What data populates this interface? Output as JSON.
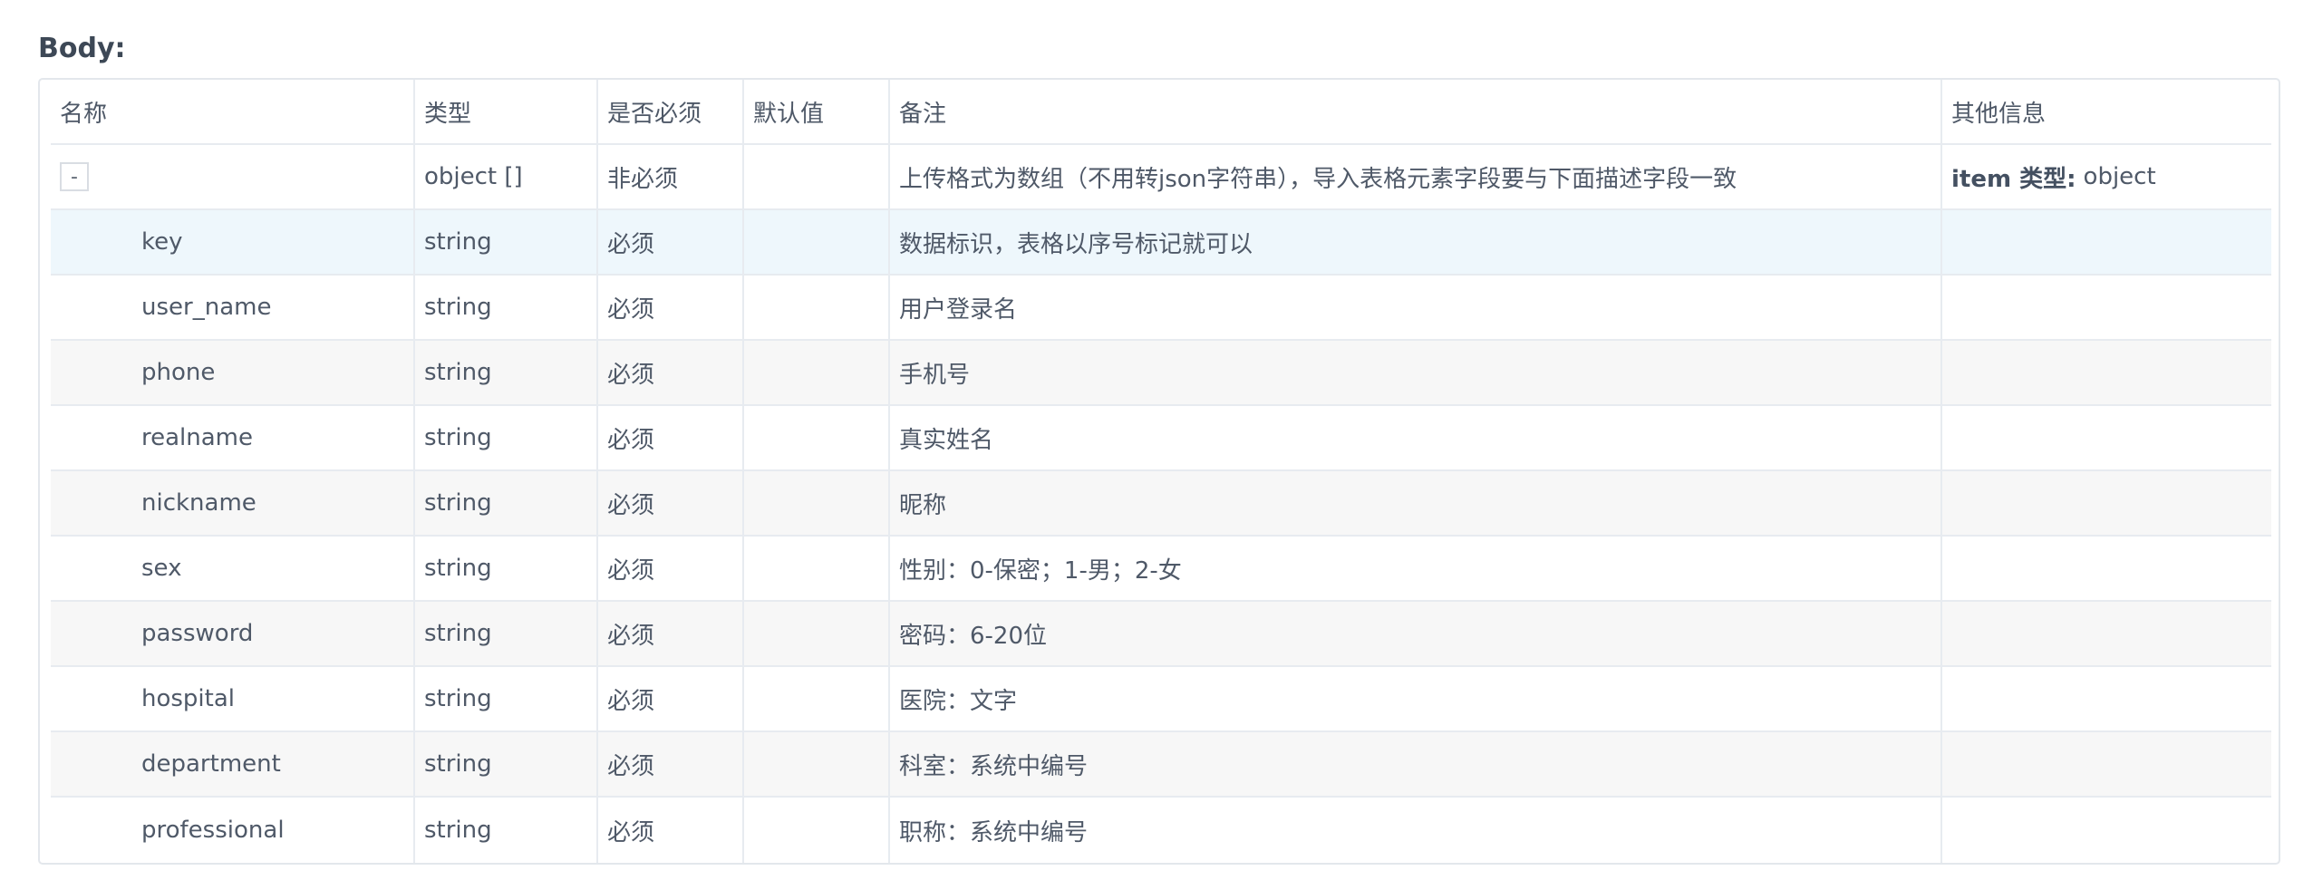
{
  "section_title": "Body:",
  "columns": [
    "名称",
    "类型",
    "是否必须",
    "默认值",
    "备注",
    "其他信息"
  ],
  "root_row": {
    "toggle_label": "-",
    "type": "object []",
    "required": "非必须",
    "default": "",
    "remark": "上传格式为数组（不用转json字符串），导入表格元素字段要与下面描述字段一致",
    "other_label": "item 类型:",
    "other_value": "object"
  },
  "rows": [
    {
      "name": "key",
      "type": "string",
      "required": "必须",
      "default": "",
      "remark": "数据标识，表格以序号标记就可以",
      "other": ""
    },
    {
      "name": "user_name",
      "type": "string",
      "required": "必须",
      "default": "",
      "remark": "用户登录名",
      "other": ""
    },
    {
      "name": "phone",
      "type": "string",
      "required": "必须",
      "default": "",
      "remark": "手机号",
      "other": ""
    },
    {
      "name": "realname",
      "type": "string",
      "required": "必须",
      "default": "",
      "remark": "真实姓名",
      "other": ""
    },
    {
      "name": "nickname",
      "type": "string",
      "required": "必须",
      "default": "",
      "remark": "昵称",
      "other": ""
    },
    {
      "name": "sex",
      "type": "string",
      "required": "必须",
      "default": "",
      "remark": "性别：0-保密；1-男；2-女",
      "other": ""
    },
    {
      "name": "password",
      "type": "string",
      "required": "必须",
      "default": "",
      "remark": "密码：6-20位",
      "other": ""
    },
    {
      "name": "hospital",
      "type": "string",
      "required": "必须",
      "default": "",
      "remark": "医院：文字",
      "other": ""
    },
    {
      "name": "department",
      "type": "string",
      "required": "必须",
      "default": "",
      "remark": "科室：系统中编号",
      "other": ""
    },
    {
      "name": "professional",
      "type": "string",
      "required": "必须",
      "default": "",
      "remark": "职称：系统中编号",
      "other": ""
    }
  ]
}
